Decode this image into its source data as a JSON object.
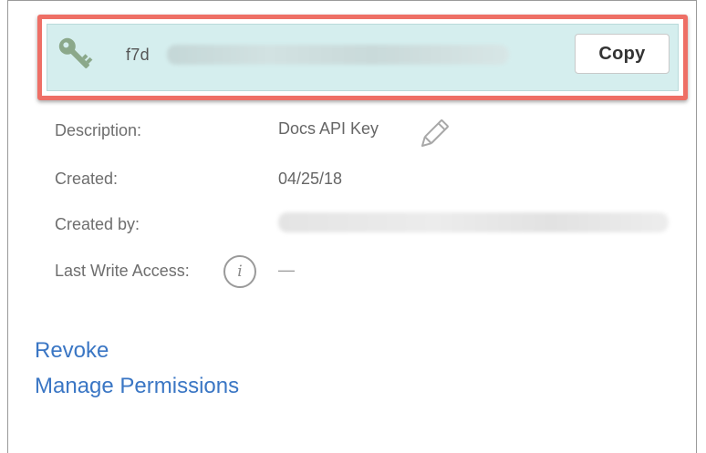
{
  "api_key": {
    "visible_prefix": "f7d",
    "copy_label": "Copy",
    "icon": "key-icon",
    "highlight_color": "#ee6f66",
    "box_color": "#d5eeee"
  },
  "details": {
    "description_label": "Description:",
    "description_value": "Docs API Key",
    "edit_icon": "pencil-icon",
    "created_label": "Created:",
    "created_value": "04/25/18",
    "created_by_label": "Created by:",
    "last_write_label": "Last Write Access:",
    "info_icon_glyph": "i",
    "last_write_value": "—"
  },
  "actions": {
    "revoke_label": "Revoke",
    "manage_label": "Manage Permissions",
    "link_color": "#3a76c4"
  }
}
